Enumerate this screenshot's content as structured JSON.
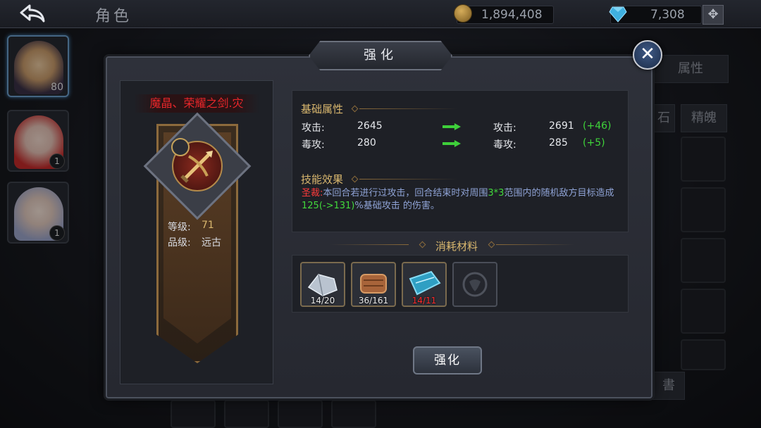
{
  "topbar": {
    "back_icon": "back-arrow-icon",
    "title": "角色",
    "gold": "1,894,408",
    "gems": "7,308",
    "plus_icon": "plus-icon"
  },
  "heroes": [
    {
      "level": "80"
    },
    {
      "level": "1"
    },
    {
      "level": "1"
    }
  ],
  "background": {
    "tab_attributes": "属性",
    "tab_soul": "精魄",
    "tab_partial_1": "石",
    "tab_partial_2": "書"
  },
  "dialog": {
    "title": "强化",
    "close_icon": "close-icon",
    "item": {
      "name": "魔晶、荣耀之剑.灾",
      "icon": "crossbow-weapon-icon",
      "level_label": "等级:",
      "level_value": "71",
      "grade_label": "品级:",
      "grade_value": "远古"
    },
    "base_attr": {
      "title": "基础属性",
      "rows": [
        {
          "label": "攻击:",
          "current": "2645",
          "new_label": "攻击:",
          "new": "2691",
          "delta": "(+46)"
        },
        {
          "label": "毒攻:",
          "current": "280",
          "new_label": "毒攻:",
          "new": "285",
          "delta": "(+5)"
        }
      ]
    },
    "skill": {
      "title": "技能效果",
      "name": "圣裁:",
      "text_1": "本回合若进行过攻击，回合结束时对周围",
      "highlight_1": "3*3",
      "text_2": "范围内的随机敌方目标造成 ",
      "highlight_2": "125(->131)",
      "text_3": "%基础攻击  的伤害。"
    },
    "materials": {
      "title": "消耗材料",
      "items": [
        {
          "icon": "steel-ingot-icon",
          "count": "14/20",
          "short": false
        },
        {
          "icon": "leather-scroll-icon",
          "count": "36/161",
          "short": false
        },
        {
          "icon": "crystal-fabric-icon",
          "count": "14/11",
          "short": true
        },
        {
          "icon": "empty-slot-emblem-icon",
          "count": "",
          "short": false
        }
      ]
    },
    "enhance_button": "强化"
  },
  "colors": {
    "item_name": "#e8262a",
    "section_title": "#d9b76e",
    "increase": "#3fd33a",
    "skill_text": "#8fa3d6",
    "shortage": "#ff2a2a"
  }
}
